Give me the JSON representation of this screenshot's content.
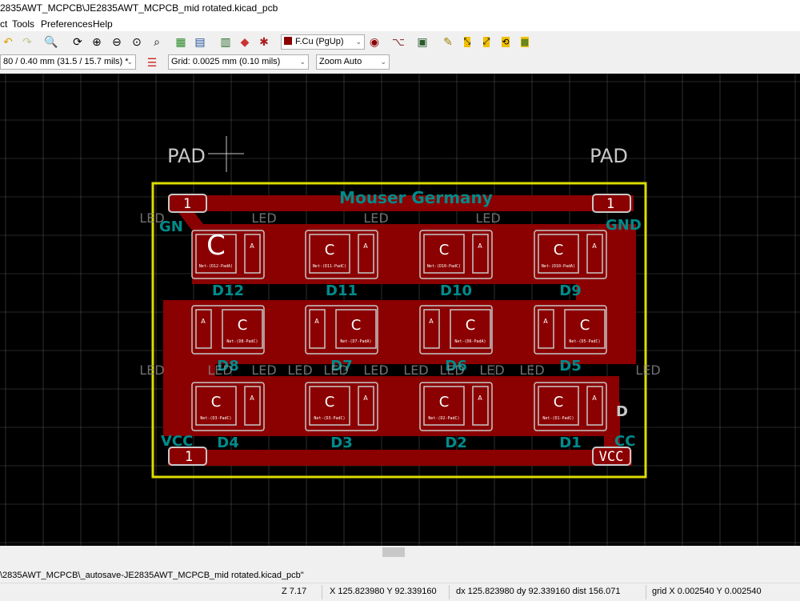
{
  "window": {
    "title": "2835AWT_MCPCB\\JE2835AWT_MCPCB_mid rotated.kicad_pcb"
  },
  "menu": {
    "items": [
      "ct",
      "Tools",
      "Preferences",
      "Help"
    ]
  },
  "toolbar": {
    "layer_select": "F.Cu (PgUp)",
    "track_width": "80 / 0.40 mm (31.5 / 15.7 mils) *",
    "grid": "Grid: 0.0025 mm (0.10 mils)",
    "zoom": "Zoom Auto",
    "icons": [
      "redo-icon",
      "undo-icon",
      "find-icon",
      "refresh-icon",
      "zoom-in-icon",
      "zoom-out-icon",
      "zoom-fit-icon",
      "zoom-area-icon",
      "netlist-icon",
      "library-icon",
      "drc-icon",
      "bug-icon",
      "layer-pair-icon",
      "ratsnest-icon",
      "board-3d-icon",
      "script-icon",
      "autoplace-icon",
      "pcb-route-icon",
      "pcb-tune-icon"
    ]
  },
  "board": {
    "pad_labels": [
      "PAD",
      "PAD"
    ],
    "pin_labels": [
      "1",
      "1",
      "1",
      "VCC"
    ],
    "net_labels": [
      "GN",
      "GND",
      "VCC",
      "CC",
      "D",
      "VCC"
    ],
    "silk_text": "Mouser Germany",
    "led_texts": [
      "LED",
      "LED",
      "LED",
      "LED",
      "LED",
      "LED",
      "LED",
      "LED",
      "LED",
      "LED",
      "LED",
      "LED",
      "LED",
      "LED",
      "LED"
    ],
    "refs": {
      "row1": [
        "D12",
        "D11",
        "D10",
        "D9"
      ],
      "row2": [
        "D8",
        "D7",
        "D6",
        "D5"
      ],
      "row3": [
        "D4",
        "D3",
        "D2",
        "D1"
      ]
    },
    "pad_c": "C",
    "pad_a": "A",
    "pad_nets": {
      "row1": [
        "Net-(D12-PadA)",
        "Net-(D11-PadC)",
        "Net-(D10-PadC)",
        "Net-(D10-PadA)"
      ],
      "row2": [
        "Net-(D8-PadC)",
        "Net-(D7-PadA)",
        "Net-(D6-PadA)",
        "Net-(D5-PadC)"
      ],
      "row3": [
        "Net-(D3-PadC)",
        "Net-(D3-PadC)",
        "Net-(D2-PadC)",
        "Net-(D1-PadC)"
      ]
    }
  },
  "status": {
    "filepath": "\\2835AWT_MCPCB\\_autosave-JE2835AWT_MCPCB_mid rotated.kicad_pcb\"",
    "zoom": "Z 7.17",
    "xy": "X 125.823980  Y 92.339160",
    "delta": "dx 125.823980  dy 92.339160  dist 156.071",
    "grid": "grid X 0.002540  Y 0.002540"
  },
  "colors": {
    "copper": "#8b0000",
    "pad": "#c8c8c8",
    "outline": "#dcdc00",
    "silk": "#008b8b",
    "grid": "#808080"
  }
}
